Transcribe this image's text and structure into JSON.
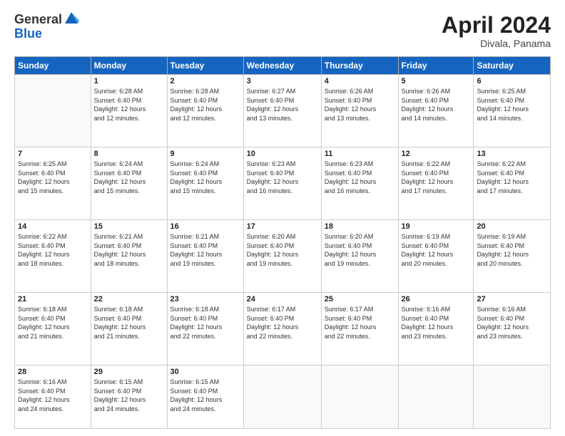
{
  "header": {
    "logo_general": "General",
    "logo_blue": "Blue",
    "month_year": "April 2024",
    "location": "Divala, Panama"
  },
  "days_of_week": [
    "Sunday",
    "Monday",
    "Tuesday",
    "Wednesday",
    "Thursday",
    "Friday",
    "Saturday"
  ],
  "weeks": [
    [
      {
        "num": "",
        "info": ""
      },
      {
        "num": "1",
        "info": "Sunrise: 6:28 AM\nSunset: 6:40 PM\nDaylight: 12 hours\nand 12 minutes."
      },
      {
        "num": "2",
        "info": "Sunrise: 6:28 AM\nSunset: 6:40 PM\nDaylight: 12 hours\nand 12 minutes."
      },
      {
        "num": "3",
        "info": "Sunrise: 6:27 AM\nSunset: 6:40 PM\nDaylight: 12 hours\nand 13 minutes."
      },
      {
        "num": "4",
        "info": "Sunrise: 6:26 AM\nSunset: 6:40 PM\nDaylight: 12 hours\nand 13 minutes."
      },
      {
        "num": "5",
        "info": "Sunrise: 6:26 AM\nSunset: 6:40 PM\nDaylight: 12 hours\nand 14 minutes."
      },
      {
        "num": "6",
        "info": "Sunrise: 6:25 AM\nSunset: 6:40 PM\nDaylight: 12 hours\nand 14 minutes."
      }
    ],
    [
      {
        "num": "7",
        "info": "Sunrise: 6:25 AM\nSunset: 6:40 PM\nDaylight: 12 hours\nand 15 minutes."
      },
      {
        "num": "8",
        "info": "Sunrise: 6:24 AM\nSunset: 6:40 PM\nDaylight: 12 hours\nand 15 minutes."
      },
      {
        "num": "9",
        "info": "Sunrise: 6:24 AM\nSunset: 6:40 PM\nDaylight: 12 hours\nand 15 minutes."
      },
      {
        "num": "10",
        "info": "Sunrise: 6:23 AM\nSunset: 6:40 PM\nDaylight: 12 hours\nand 16 minutes."
      },
      {
        "num": "11",
        "info": "Sunrise: 6:23 AM\nSunset: 6:40 PM\nDaylight: 12 hours\nand 16 minutes."
      },
      {
        "num": "12",
        "info": "Sunrise: 6:22 AM\nSunset: 6:40 PM\nDaylight: 12 hours\nand 17 minutes."
      },
      {
        "num": "13",
        "info": "Sunrise: 6:22 AM\nSunset: 6:40 PM\nDaylight: 12 hours\nand 17 minutes."
      }
    ],
    [
      {
        "num": "14",
        "info": "Sunrise: 6:22 AM\nSunset: 6:40 PM\nDaylight: 12 hours\nand 18 minutes."
      },
      {
        "num": "15",
        "info": "Sunrise: 6:21 AM\nSunset: 6:40 PM\nDaylight: 12 hours\nand 18 minutes."
      },
      {
        "num": "16",
        "info": "Sunrise: 6:21 AM\nSunset: 6:40 PM\nDaylight: 12 hours\nand 19 minutes."
      },
      {
        "num": "17",
        "info": "Sunrise: 6:20 AM\nSunset: 6:40 PM\nDaylight: 12 hours\nand 19 minutes."
      },
      {
        "num": "18",
        "info": "Sunrise: 6:20 AM\nSunset: 6:40 PM\nDaylight: 12 hours\nand 19 minutes."
      },
      {
        "num": "19",
        "info": "Sunrise: 6:19 AM\nSunset: 6:40 PM\nDaylight: 12 hours\nand 20 minutes."
      },
      {
        "num": "20",
        "info": "Sunrise: 6:19 AM\nSunset: 6:40 PM\nDaylight: 12 hours\nand 20 minutes."
      }
    ],
    [
      {
        "num": "21",
        "info": "Sunrise: 6:18 AM\nSunset: 6:40 PM\nDaylight: 12 hours\nand 21 minutes."
      },
      {
        "num": "22",
        "info": "Sunrise: 6:18 AM\nSunset: 6:40 PM\nDaylight: 12 hours\nand 21 minutes."
      },
      {
        "num": "23",
        "info": "Sunrise: 6:18 AM\nSunset: 6:40 PM\nDaylight: 12 hours\nand 22 minutes."
      },
      {
        "num": "24",
        "info": "Sunrise: 6:17 AM\nSunset: 6:40 PM\nDaylight: 12 hours\nand 22 minutes."
      },
      {
        "num": "25",
        "info": "Sunrise: 6:17 AM\nSunset: 6:40 PM\nDaylight: 12 hours\nand 22 minutes."
      },
      {
        "num": "26",
        "info": "Sunrise: 6:16 AM\nSunset: 6:40 PM\nDaylight: 12 hours\nand 23 minutes."
      },
      {
        "num": "27",
        "info": "Sunrise: 6:16 AM\nSunset: 6:40 PM\nDaylight: 12 hours\nand 23 minutes."
      }
    ],
    [
      {
        "num": "28",
        "info": "Sunrise: 6:16 AM\nSunset: 6:40 PM\nDaylight: 12 hours\nand 24 minutes."
      },
      {
        "num": "29",
        "info": "Sunrise: 6:15 AM\nSunset: 6:40 PM\nDaylight: 12 hours\nand 24 minutes."
      },
      {
        "num": "30",
        "info": "Sunrise: 6:15 AM\nSunset: 6:40 PM\nDaylight: 12 hours\nand 24 minutes."
      },
      {
        "num": "",
        "info": ""
      },
      {
        "num": "",
        "info": ""
      },
      {
        "num": "",
        "info": ""
      },
      {
        "num": "",
        "info": ""
      }
    ]
  ]
}
